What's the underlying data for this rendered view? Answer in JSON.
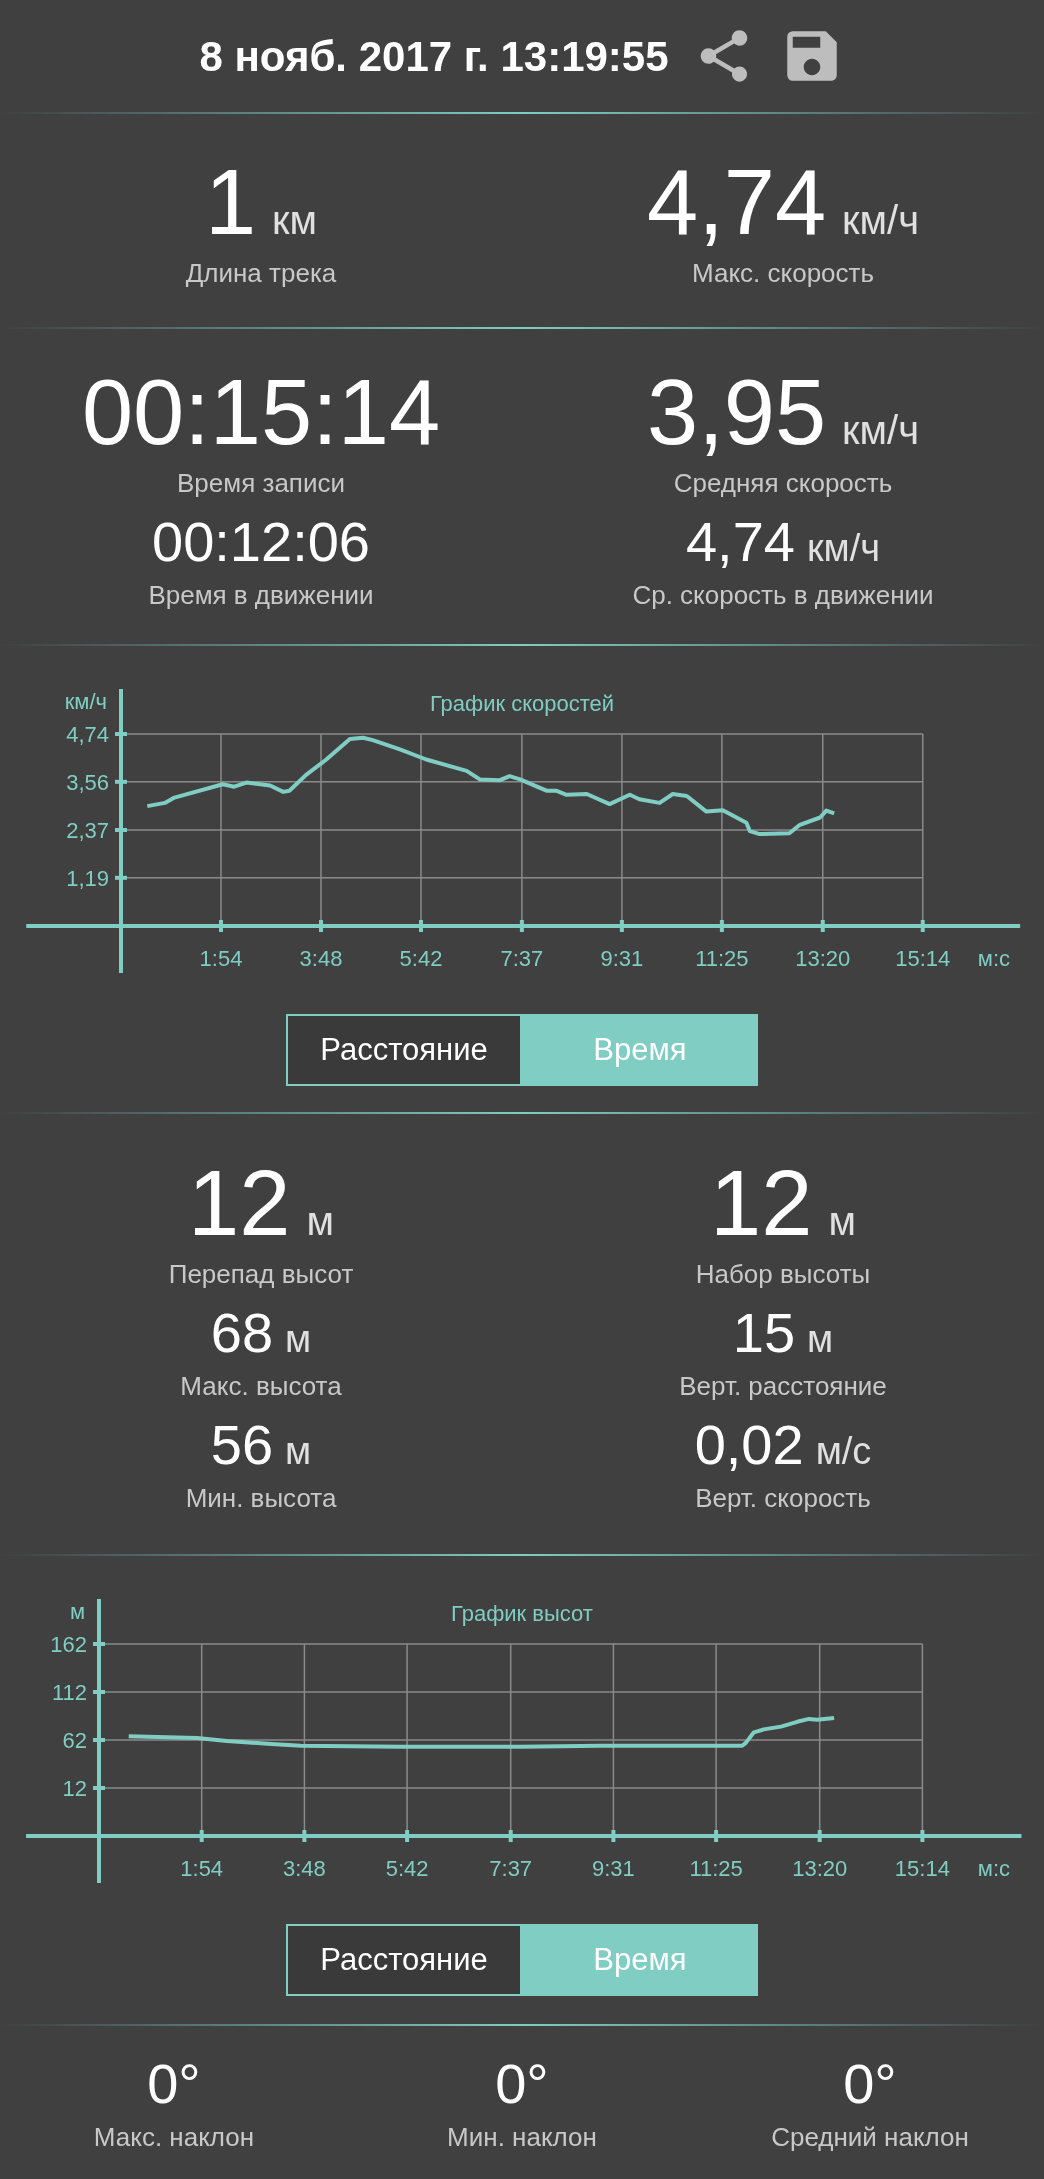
{
  "header": {
    "datetime": "8 нояб. 2017 г. 13:19:55"
  },
  "summary": [
    {
      "value": "1",
      "unit": "км",
      "label": "Длина трека"
    },
    {
      "value": "4,74",
      "unit": "км/ч",
      "label": "Макс. скорость"
    }
  ],
  "time_stats": [
    [
      {
        "value": "00:15:14",
        "label": "Время записи"
      },
      {
        "value": "00:12:06",
        "label": "Время в движении"
      }
    ],
    [
      {
        "value": "3,95",
        "unit": "км/ч",
        "label": "Средняя скорость"
      },
      {
        "value": "4,74",
        "unit": "км/ч",
        "label": "Ср. скорость в движении"
      }
    ]
  ],
  "speed_chart": {
    "chart_data": {
      "type": "line",
      "title": "График скоростей",
      "xlabel": "м:с",
      "ylabel": "км/ч",
      "xlim": [
        -108,
        1025
      ],
      "ylim": [
        0,
        5.85
      ],
      "grid": true,
      "xticks": [
        {
          "value": 114,
          "label": "1:54"
        },
        {
          "value": 228,
          "label": "3:48"
        },
        {
          "value": 342,
          "label": "5:42"
        },
        {
          "value": 457,
          "label": "7:37"
        },
        {
          "value": 571,
          "label": "9:31"
        },
        {
          "value": 685,
          "label": "11:25"
        },
        {
          "value": 800,
          "label": "13:20"
        },
        {
          "value": 914,
          "label": "15:14"
        }
      ],
      "yticks": [
        {
          "value": 1.19,
          "label": "1,19"
        },
        {
          "value": 2.37,
          "label": "2,37"
        },
        {
          "value": 3.56,
          "label": "3,56"
        },
        {
          "value": 4.74,
          "label": "4,74"
        }
      ],
      "x": [
        30,
        50,
        61,
        116,
        129,
        143,
        170,
        185,
        192,
        211,
        234,
        261,
        276,
        287,
        318,
        348,
        394,
        409,
        432,
        443,
        455,
        485,
        496,
        508,
        531,
        557,
        580,
        591,
        614,
        629,
        645,
        667,
        686,
        713,
        717,
        728,
        762,
        774,
        797,
        804,
        813
      ],
      "series": [
        {
          "color": "#7fcdc3",
          "values": [
            2.96,
            3.04,
            3.17,
            3.5,
            3.44,
            3.54,
            3.47,
            3.31,
            3.34,
            3.73,
            4.11,
            4.62,
            4.65,
            4.59,
            4.36,
            4.11,
            3.83,
            3.62,
            3.6,
            3.7,
            3.62,
            3.34,
            3.34,
            3.24,
            3.26,
            3.01,
            3.24,
            3.13,
            3.04,
            3.26,
            3.21,
            2.83,
            2.86,
            2.55,
            2.34,
            2.27,
            2.29,
            2.5,
            2.68,
            2.85,
            2.78
          ]
        }
      ]
    },
    "mode_toggle": [
      {
        "label": "Расстояние",
        "selected": false
      },
      {
        "label": "Время",
        "selected": true
      }
    ]
  },
  "altitude_stats": [
    [
      {
        "value": "12",
        "unit": "м",
        "label": "Перепад высот"
      },
      {
        "value": "68",
        "unit": "м",
        "label": "Макс. высота"
      },
      {
        "value": "56",
        "unit": "м",
        "label": "Мин. высота"
      }
    ],
    [
      {
        "value": "12",
        "unit": "м",
        "label": "Набор высоты"
      },
      {
        "value": "15",
        "unit": "м",
        "label": "Верт. расстояние"
      },
      {
        "value": "0,02",
        "unit": "м/с",
        "label": "Верт. скорость"
      }
    ]
  ],
  "altitude_chart": {
    "chart_data": {
      "type": "line",
      "title": "График высот",
      "xlabel": "м:с",
      "ylabel": "м",
      "xlim": [
        -81,
        1024
      ],
      "ylim": [
        -38,
        209
      ],
      "grid": true,
      "xticks": [
        {
          "value": 114,
          "label": "1:54"
        },
        {
          "value": 228,
          "label": "3:48"
        },
        {
          "value": 342,
          "label": "5:42"
        },
        {
          "value": 457,
          "label": "7:37"
        },
        {
          "value": 571,
          "label": "9:31"
        },
        {
          "value": 685,
          "label": "11:25"
        },
        {
          "value": 800,
          "label": "13:20"
        },
        {
          "value": 914,
          "label": "15:14"
        }
      ],
      "yticks": [
        12,
        62,
        112,
        162
      ],
      "x": [
        33,
        109,
        142,
        187,
        224,
        335,
        468,
        557,
        714,
        718,
        727,
        738,
        757,
        775,
        788,
        797,
        816
      ],
      "series": [
        {
          "color": "#7fcdc3",
          "values": [
            66,
            64,
            61,
            58,
            56,
            55,
            55,
            56,
            56,
            59,
            70,
            73,
            76,
            81,
            84,
            83,
            85
          ]
        }
      ]
    },
    "mode_toggle": [
      {
        "label": "Расстояние",
        "selected": false
      },
      {
        "label": "Время",
        "selected": true
      }
    ]
  },
  "slope_stats": [
    {
      "value": "0°",
      "label": "Макс. наклон"
    },
    {
      "value": "0°",
      "label": "Мин. наклон"
    },
    {
      "value": "0°",
      "label": "Средний наклон"
    }
  ]
}
